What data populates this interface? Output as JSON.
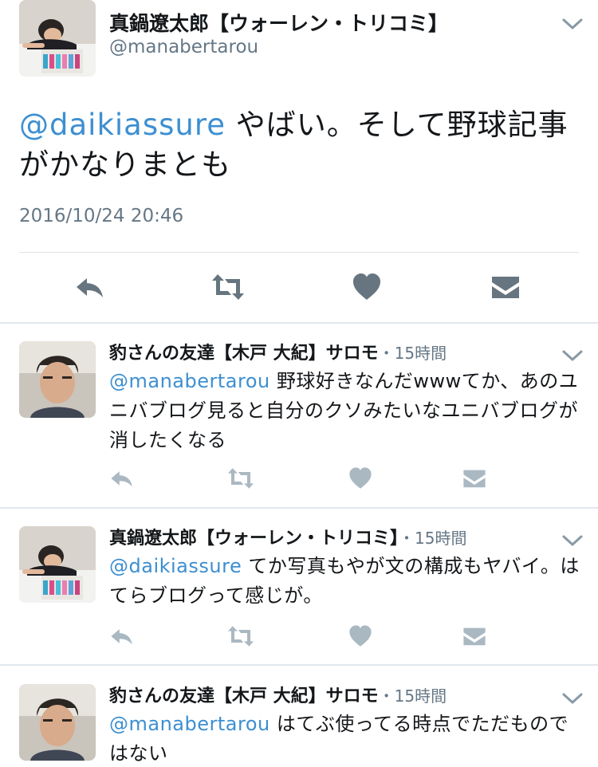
{
  "main": {
    "display_name": "真鍋遼太郎【ウォーレン・トリコミ】",
    "handle": "@manabertarou",
    "mention": "@daikiassure",
    "text": " やばい。そして野球記事がかなりまとも",
    "timestamp": "2016/10/24 20:46",
    "icons": [
      "reply-icon",
      "retweet-icon",
      "heart-icon",
      "envelope-icon"
    ]
  },
  "replies": [
    {
      "display_name": "豹さんの友達【木戸 大紀】サロモ",
      "dot": "・",
      "time": "15時間",
      "mention": "@manabertarou",
      "text": " 野球好きなんだwwwてか、あのユニバブログ見ると自分のクソみたいなユニバブログが消したくなる"
    },
    {
      "display_name": "真鍋遼太郎【ウォーレン・トリコミ】",
      "dot": "・",
      "time": "15時間",
      "mention": "@daikiassure",
      "text": " てか写真もやが文の構成もヤバイ。はてらブログって感じが。"
    },
    {
      "display_name": "豹さんの友達【木戸 大紀】サロモ",
      "dot": "・",
      "time": "15時間",
      "mention": "@manabertarou",
      "text": " はてぶ使ってる時点でただものではない"
    }
  ],
  "colors": {
    "mention": "#3d8fd1",
    "secondary_text": "#657786",
    "main_action_icon": "#66757f",
    "reply_action_icon": "#aab8c2",
    "divider": "#e1e8ed"
  }
}
